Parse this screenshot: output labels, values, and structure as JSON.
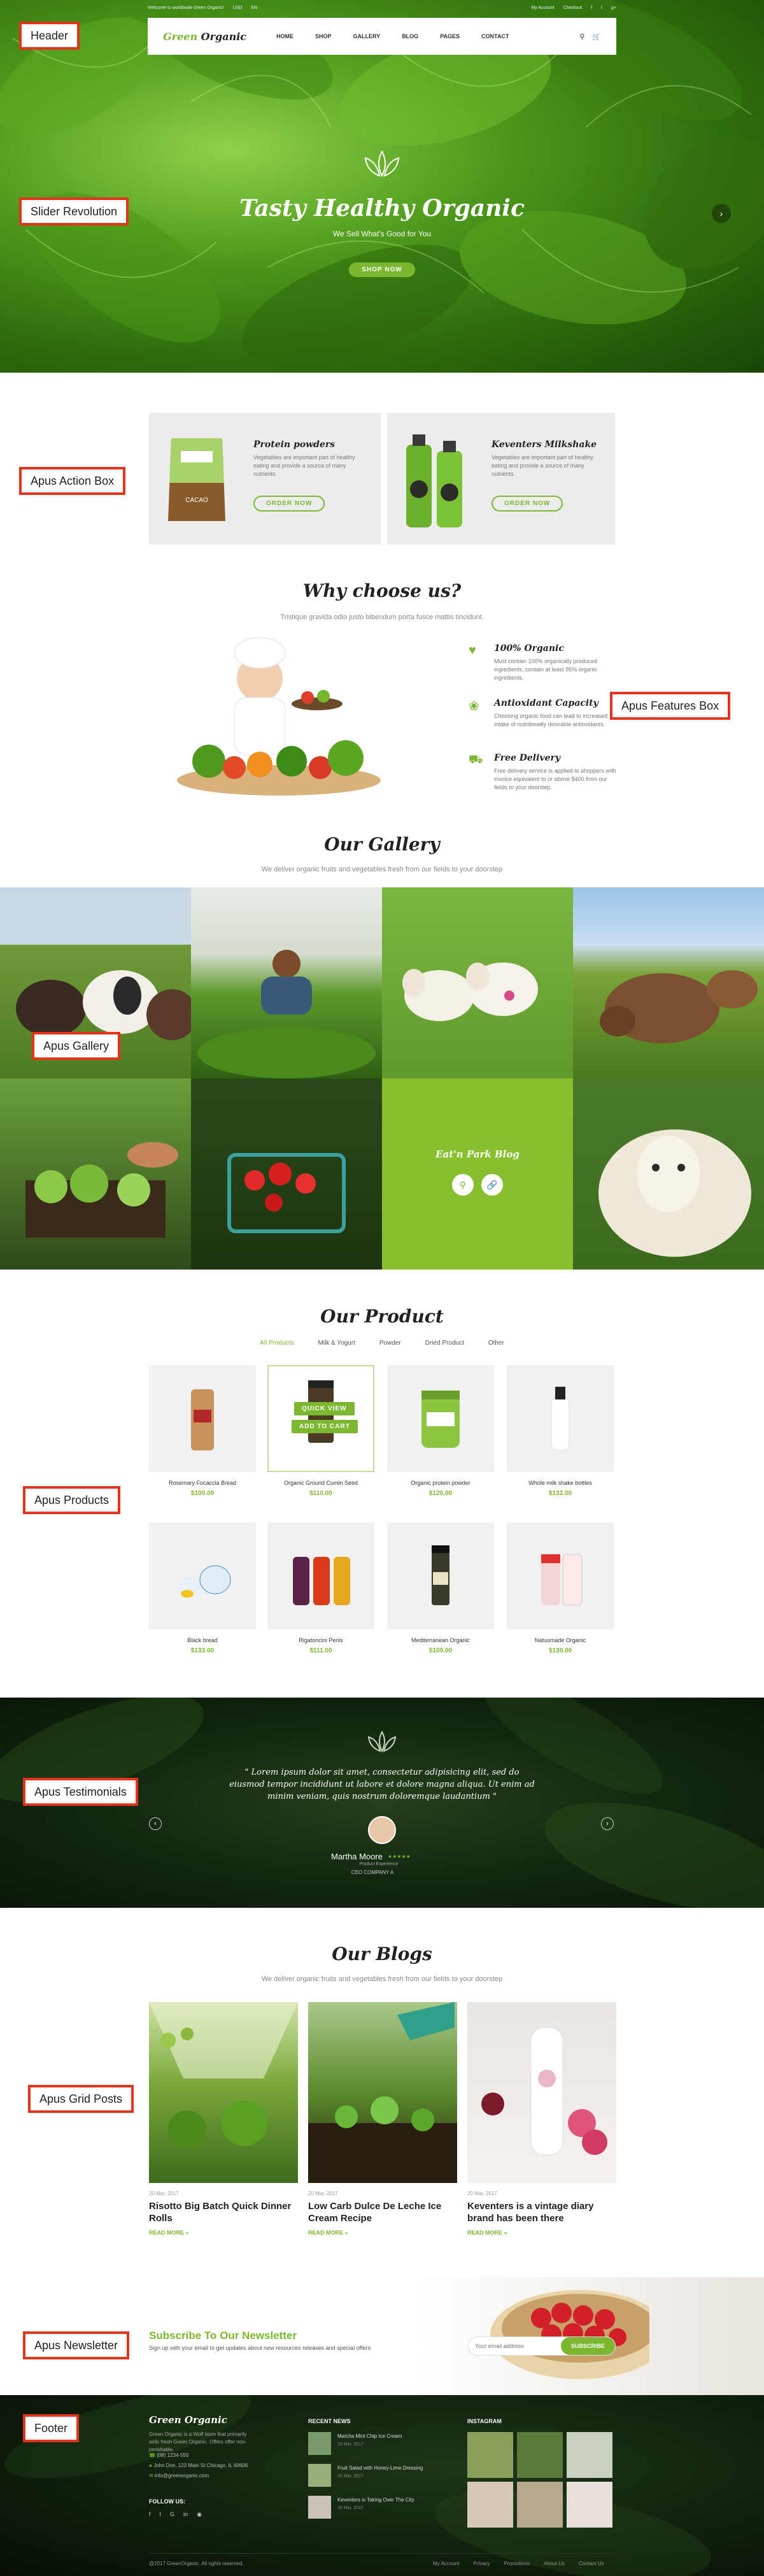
{
  "topbar": {
    "welcome": "Welcome to worldwide Green Organic!",
    "currency": "USD",
    "language": "EN",
    "links": [
      "My Account",
      "Checkout"
    ]
  },
  "nav": {
    "logo_a": "Green",
    "logo_b": "Organic",
    "items": [
      "HOME",
      "SHOP",
      "GALLERY",
      "BLOG",
      "PAGES",
      "CONTACT"
    ]
  },
  "hero": {
    "title": "Tasty Healthy Organic",
    "subtitle": "We Sell What's Good for You",
    "button": "SHOP NOW"
  },
  "labels": {
    "header": "Header",
    "slider": "Slider Revolution",
    "action": "Apus Action Box",
    "features": "Apus Features Box",
    "gallery": "Apus Gallery",
    "products": "Apus Products",
    "testimonials": "Apus Testimonials",
    "grid": "Apus Grid Posts",
    "newsletter": "Apus Newsletter",
    "footer": "Footer"
  },
  "action_boxes": [
    {
      "title": "Protein powders",
      "text": "Vegetables are important part of healthy eating and provide a source of many nutrients.",
      "button": "ORDER NOW"
    },
    {
      "title": "Keventers Milkshake",
      "text": "Vegetables are important part of healthy eating and provide a source of many nutrients.",
      "button": "ORDER NOW"
    }
  ],
  "why": {
    "title": "Why choose us?",
    "subtitle": "Tristique gravida odio justo bibendum porta fusce mattis tincidunt.",
    "features": [
      {
        "title": "100% Organic",
        "text": "Must contain 100% organically produced ingredients, contain at least 95% organic ingredients."
      },
      {
        "title": "Antioxidant Capacity",
        "text": "Choosing organic food can lead to increased intake of nutritionally desirable antioxidants."
      },
      {
        "title": "Free Delivery",
        "text": "Free delivery service is applied to shoppers with invoice equivalent to or above $400 from our fields to your doorstep."
      }
    ]
  },
  "gallery": {
    "title": "Our Gallery",
    "subtitle": "We deliver organic fruits and vegetables fresh from our fields to your doorstep",
    "overlay_title": "Eat'n Park Blog"
  },
  "products": {
    "title": "Our Product",
    "tabs": [
      "All Products",
      "Milk & Yogurt",
      "Powder",
      "Dried Product",
      "Other"
    ],
    "quick_view": "QUICK VIEW",
    "add_to_cart": "ADD TO CART",
    "items": [
      {
        "name": "Rosemary Focaccia Bread",
        "price": "$100.00"
      },
      {
        "name": "Organic Ground Cumin Seed",
        "price": "$110.00"
      },
      {
        "name": "Organic protein powder",
        "price": "$120.00"
      },
      {
        "name": "Whole milk shake bottles",
        "price": "$132.00"
      },
      {
        "name": "Black bread",
        "price": "$133.00"
      },
      {
        "name": "Rigatoncini Penis",
        "price": "$111.00"
      },
      {
        "name": "Mediterranean Organic",
        "price": "$109.00"
      },
      {
        "name": "Natuumade Organic",
        "price": "$139.00"
      }
    ]
  },
  "testimonial": {
    "quote": "\" Lorem ipsum dolor sit amet, consectetur adipisicing elit, sed do eiusmod tempor incididunt ut labore et dolore magna aliqua. Ut enim ad minim veniam, quis nostrum doloremque laudantium \"",
    "name": "Martha Moore",
    "rating": "★★★★★",
    "company": "Product Experience",
    "role": "CEO COMPANY A"
  },
  "blogs": {
    "title": "Our Blogs",
    "subtitle": "We deliver organic fruits and vegetables fresh from our fields to your doorstep",
    "read_more": "READ MORE »",
    "posts": [
      {
        "date": "20 Mar, 2017",
        "title": "Risotto Big Batch Quick Dinner Rolls"
      },
      {
        "date": "20 Mar, 2017",
        "title": "Low Carb Dulce De Leche Ice Cream Recipe"
      },
      {
        "date": "20 Mar, 2017",
        "title": "Keventers is a vintage diary brand has been there"
      }
    ]
  },
  "newsletter": {
    "title": "Subscribe To Our Newsletter",
    "text": "Sign up with your email to get updates about new resources releases and special offers",
    "placeholder": "Your email address",
    "button": "SUBSCRIBE"
  },
  "footer": {
    "logo": "Green Organic",
    "about": "Green Organic is a Wolf store that primarily sells fresh Green Organic. Offers offer non-perishable.",
    "phone": "(08) 1234-555",
    "address": "John Doe, 123 Main St Chicago, IL 60606",
    "email": "info@greenorganic.com",
    "follow": "FOLLOW US:",
    "recent_title": "RECENT NEWS",
    "news": [
      {
        "title": "Matcha Mint Chip Ice Cream",
        "date": "20 Mar, 2017"
      },
      {
        "title": "Fruit Salad with Honey-Lime Dressing",
        "date": "20 Mar, 2017"
      },
      {
        "title": "Keventers is Taking Over The City",
        "date": "20 Mar, 2017"
      }
    ],
    "instagram_title": "INSTAGRAM",
    "copyright": "@2017 GreenOrganic. All rights reserved.",
    "bottom_links": [
      "My Account",
      "Privacy",
      "Promotions",
      "About Us",
      "Contact Us"
    ]
  }
}
